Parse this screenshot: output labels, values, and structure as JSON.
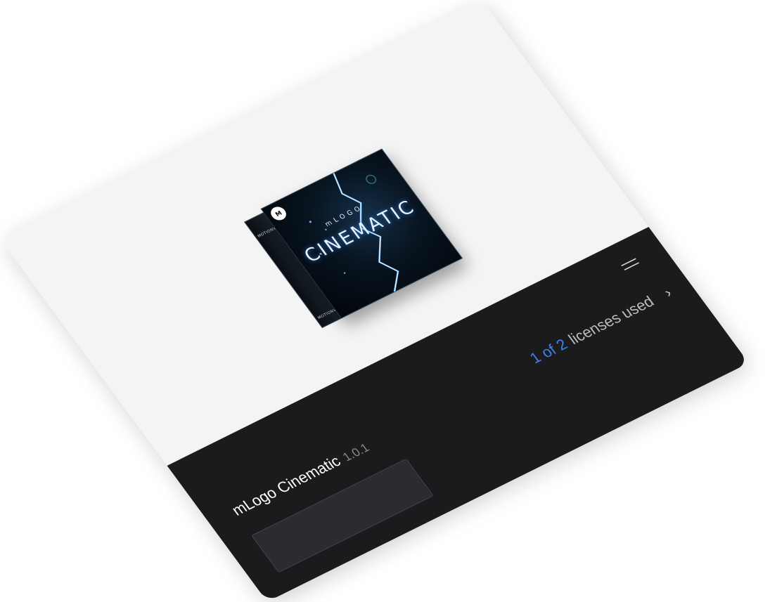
{
  "product": {
    "name": "mLogo Cinematic",
    "version": "1.0.1",
    "box_brand": "MOTIONVFX",
    "box_subtitle": "mLOGO",
    "box_title": "CINEMATIC",
    "box_logo": "M"
  },
  "licenses": {
    "used": "1 of 2",
    "label": "licenses used"
  },
  "icons": {
    "menu": "menu-icon",
    "chevron": "chevron-right-icon"
  },
  "colors": {
    "accent": "#3a82f0",
    "bar_background": "#1b1b1d",
    "card_background": "#f4f4f4"
  }
}
